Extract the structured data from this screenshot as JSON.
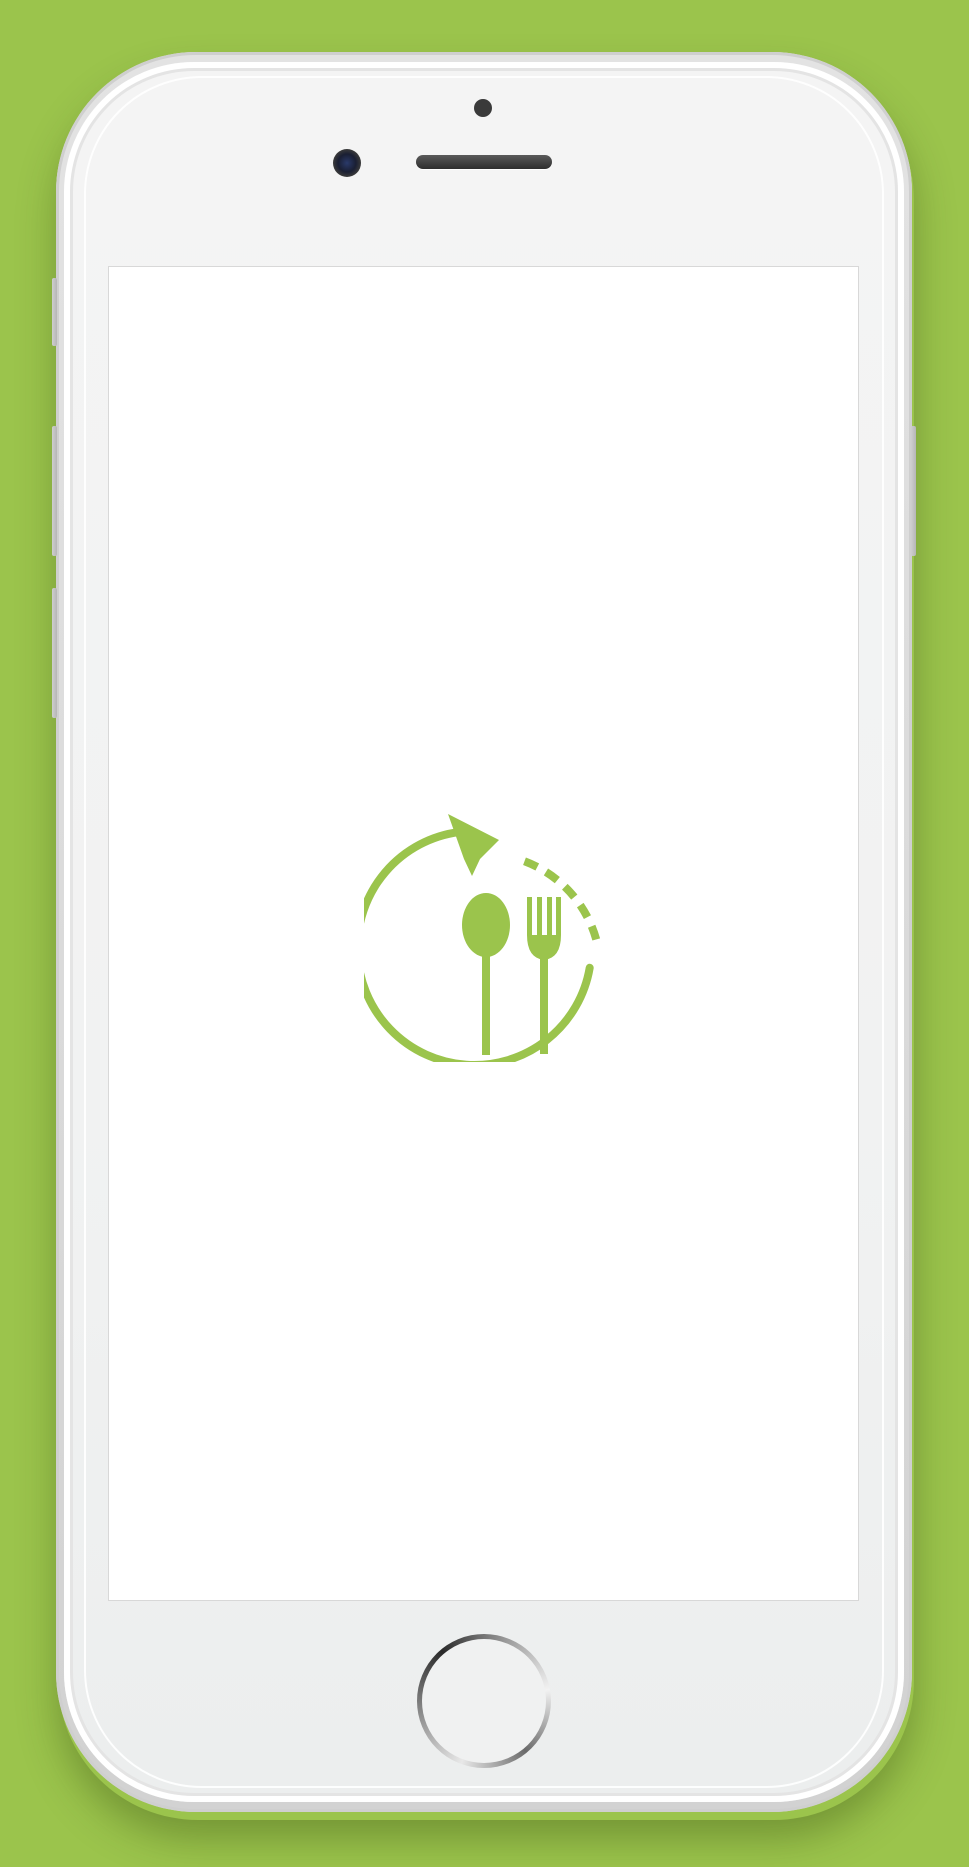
{
  "device": {
    "frame": "smartphone",
    "background_color": "#9bc44c",
    "frame_color": "#f1f2f2"
  },
  "screen": {
    "background_color": "#ffffff",
    "logo": {
      "icon": "meal-cycle-icon",
      "parts": [
        "circular-arrow",
        "dashed-arc",
        "spoon-icon",
        "fork-icon"
      ],
      "color": "#9bc44c"
    }
  },
  "controls": {
    "home_button": "home-button"
  }
}
